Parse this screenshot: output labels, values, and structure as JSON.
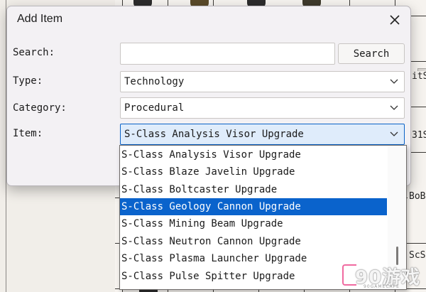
{
  "dialog": {
    "title": "Add Item",
    "close_icon": "close-icon"
  },
  "form": {
    "search_label": "Search:",
    "search_value": "",
    "search_button": "Search",
    "type_label": "Type:",
    "type_value": "Technology",
    "category_label": "Category:",
    "category_value": "Procedural",
    "item_label": "Item:",
    "item_value": "S-Class Analysis Visor Upgrade"
  },
  "dropdown": {
    "options": [
      "S-Class Analysis Visor Upgrade",
      "S-Class Blaze Javelin Upgrade",
      "S-Class Boltcaster Upgrade",
      "S-Class Geology Cannon Upgrade",
      "S-Class Mining Beam Upgrade",
      "S-Class Neutron Cannon Upgrade",
      "S-Class Plasma Launcher Upgrade",
      "S-Class Pulse Spitter Upgrade"
    ],
    "highlighted_index": 3,
    "highlight_color": "#0a63cc"
  },
  "background": {
    "cells": [
      "itS",
      "31S",
      "BoB",
      "ScS"
    ]
  },
  "watermark": {
    "text": "90游戏",
    "sub": "90GAMECAFE"
  },
  "colors": {
    "accent": "#0a62c7",
    "dialog_bg": "#f3f1f4"
  }
}
